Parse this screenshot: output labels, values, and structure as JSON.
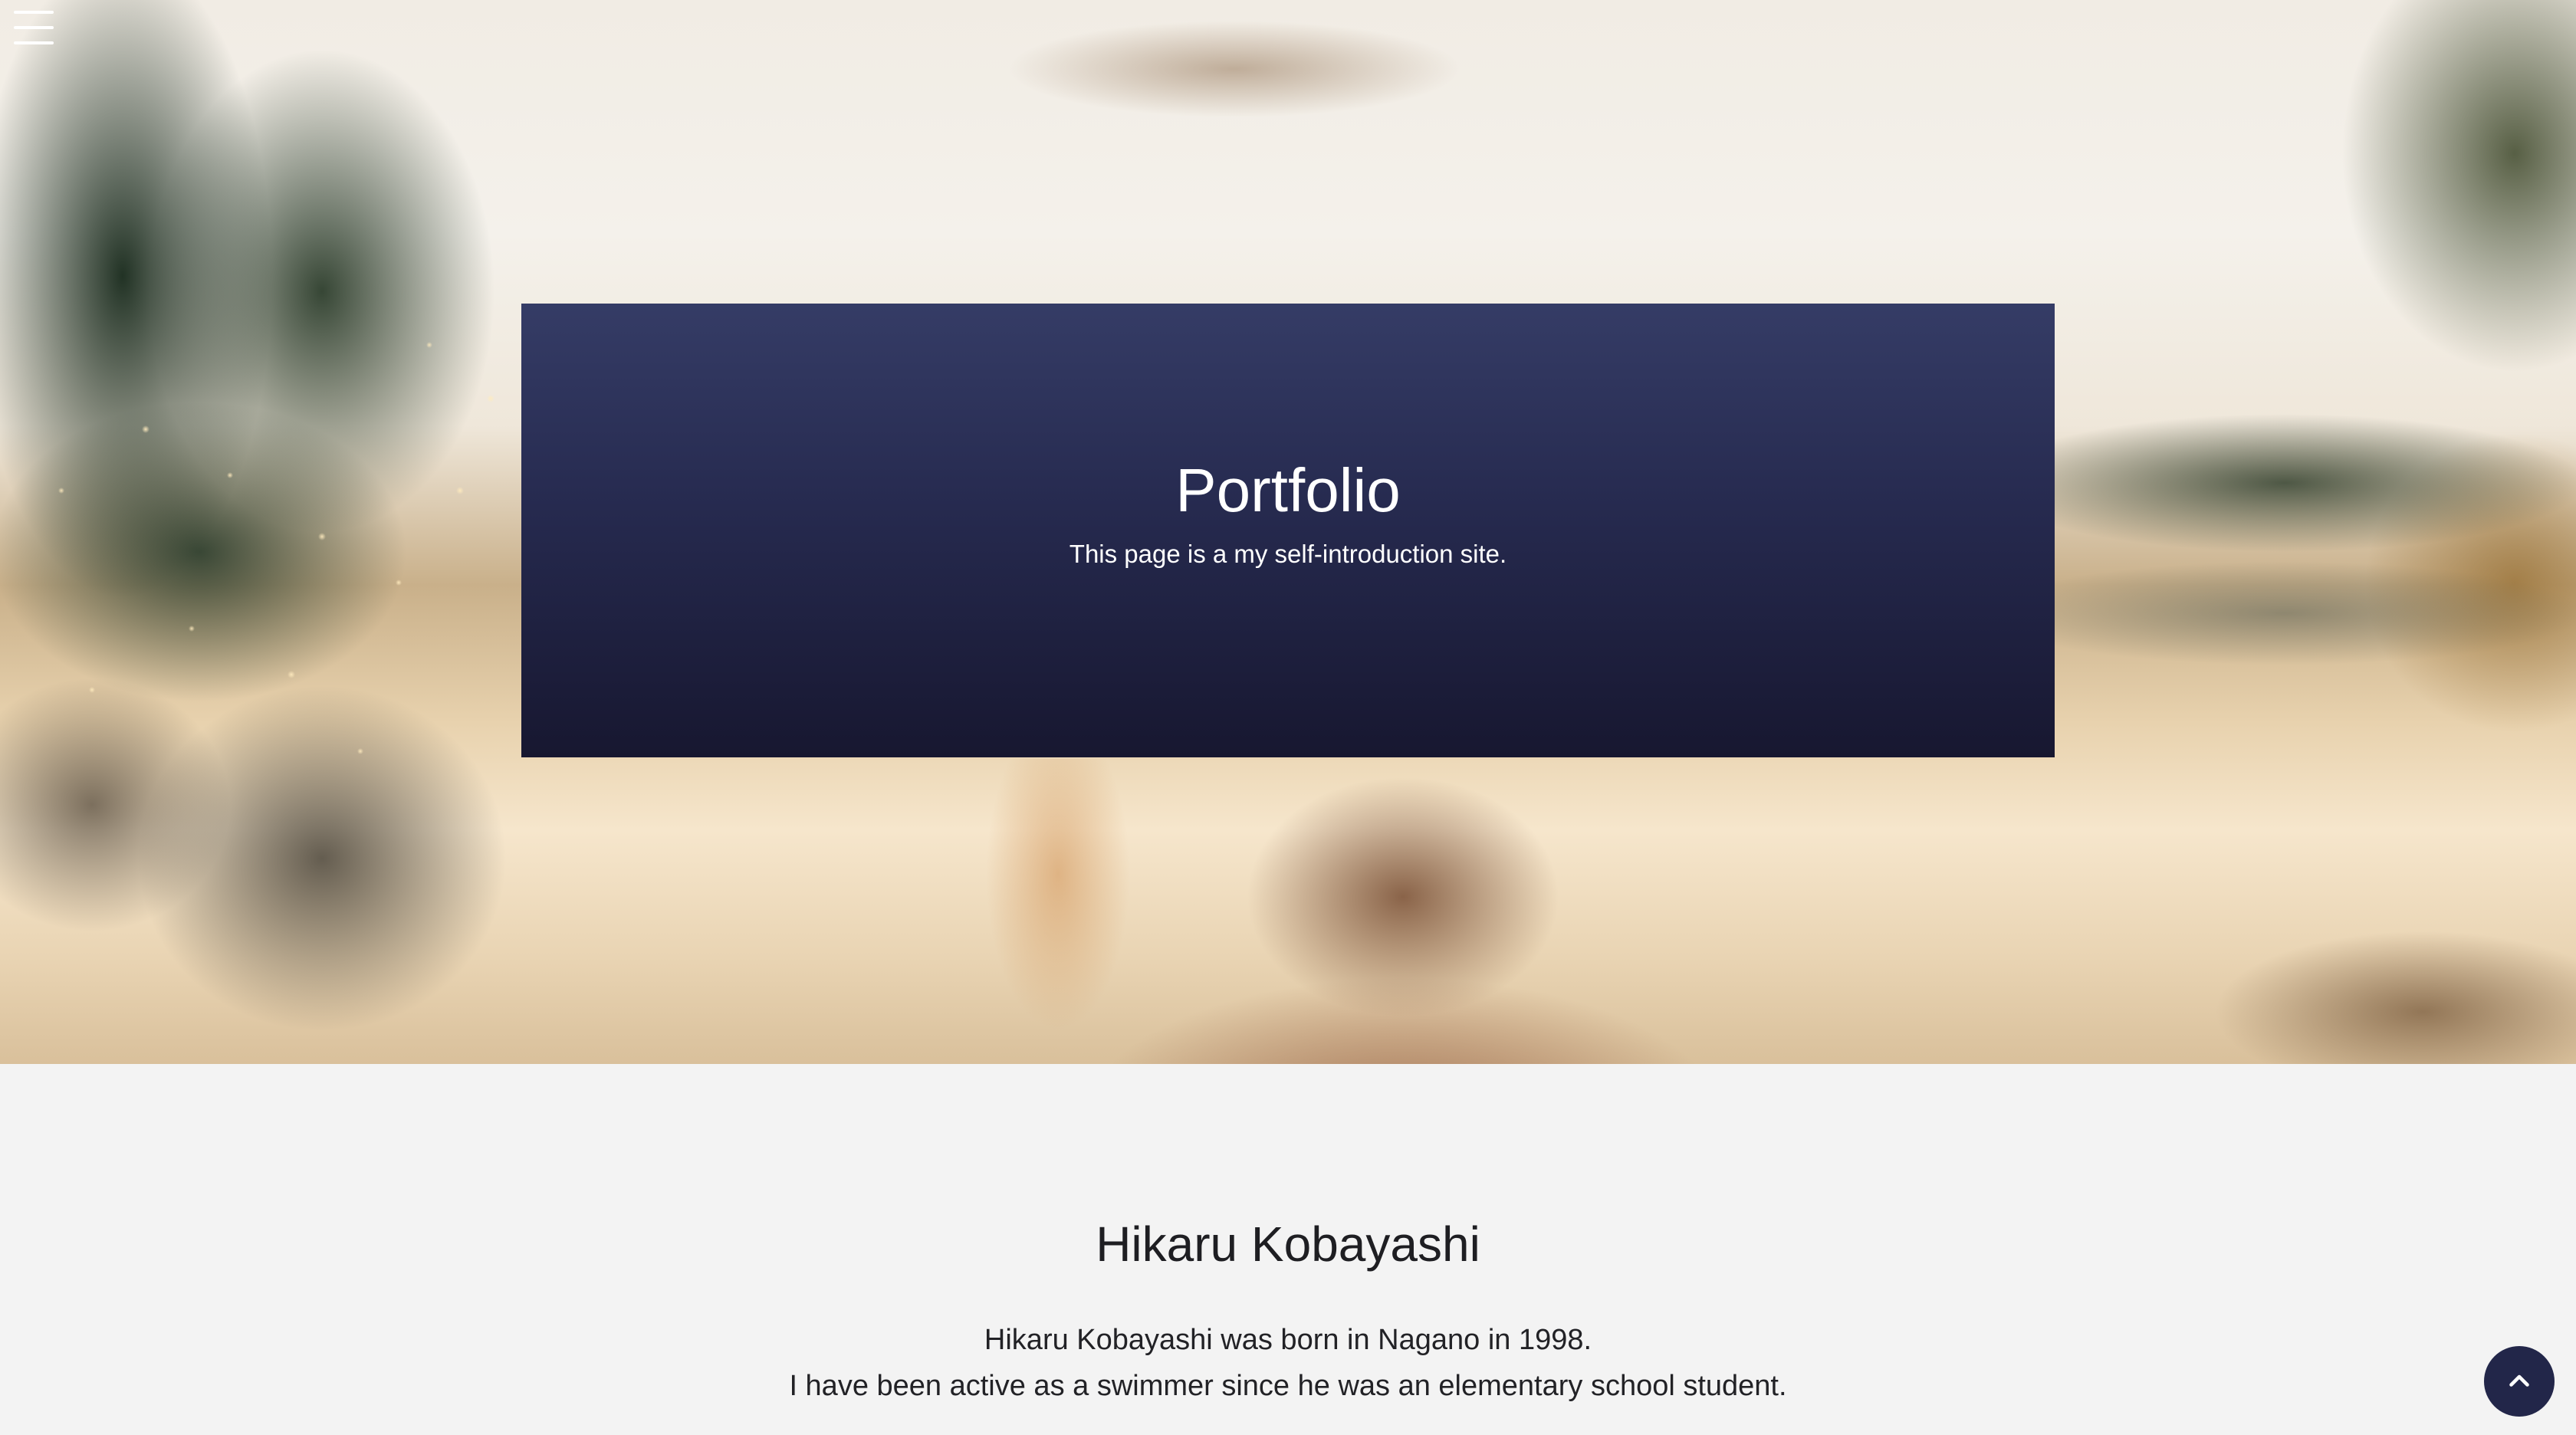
{
  "hero": {
    "title": "Portfolio",
    "subtitle": "This page is a my self-introduction site."
  },
  "intro": {
    "name": "Hikaru Kobayashi",
    "bio_lines": [
      "Hikaru Kobayashi was born in Nagano in 1998.",
      "I have been active as a swimmer since he was an elementary school student."
    ]
  },
  "icons": {
    "menu": "hamburger-menu-icon",
    "back_to_top": "chevron-up-icon"
  },
  "colors": {
    "card_top": "#353c66",
    "card_bottom": "#171730",
    "page_background": "#f3f3f3",
    "top_button": "#222649"
  }
}
